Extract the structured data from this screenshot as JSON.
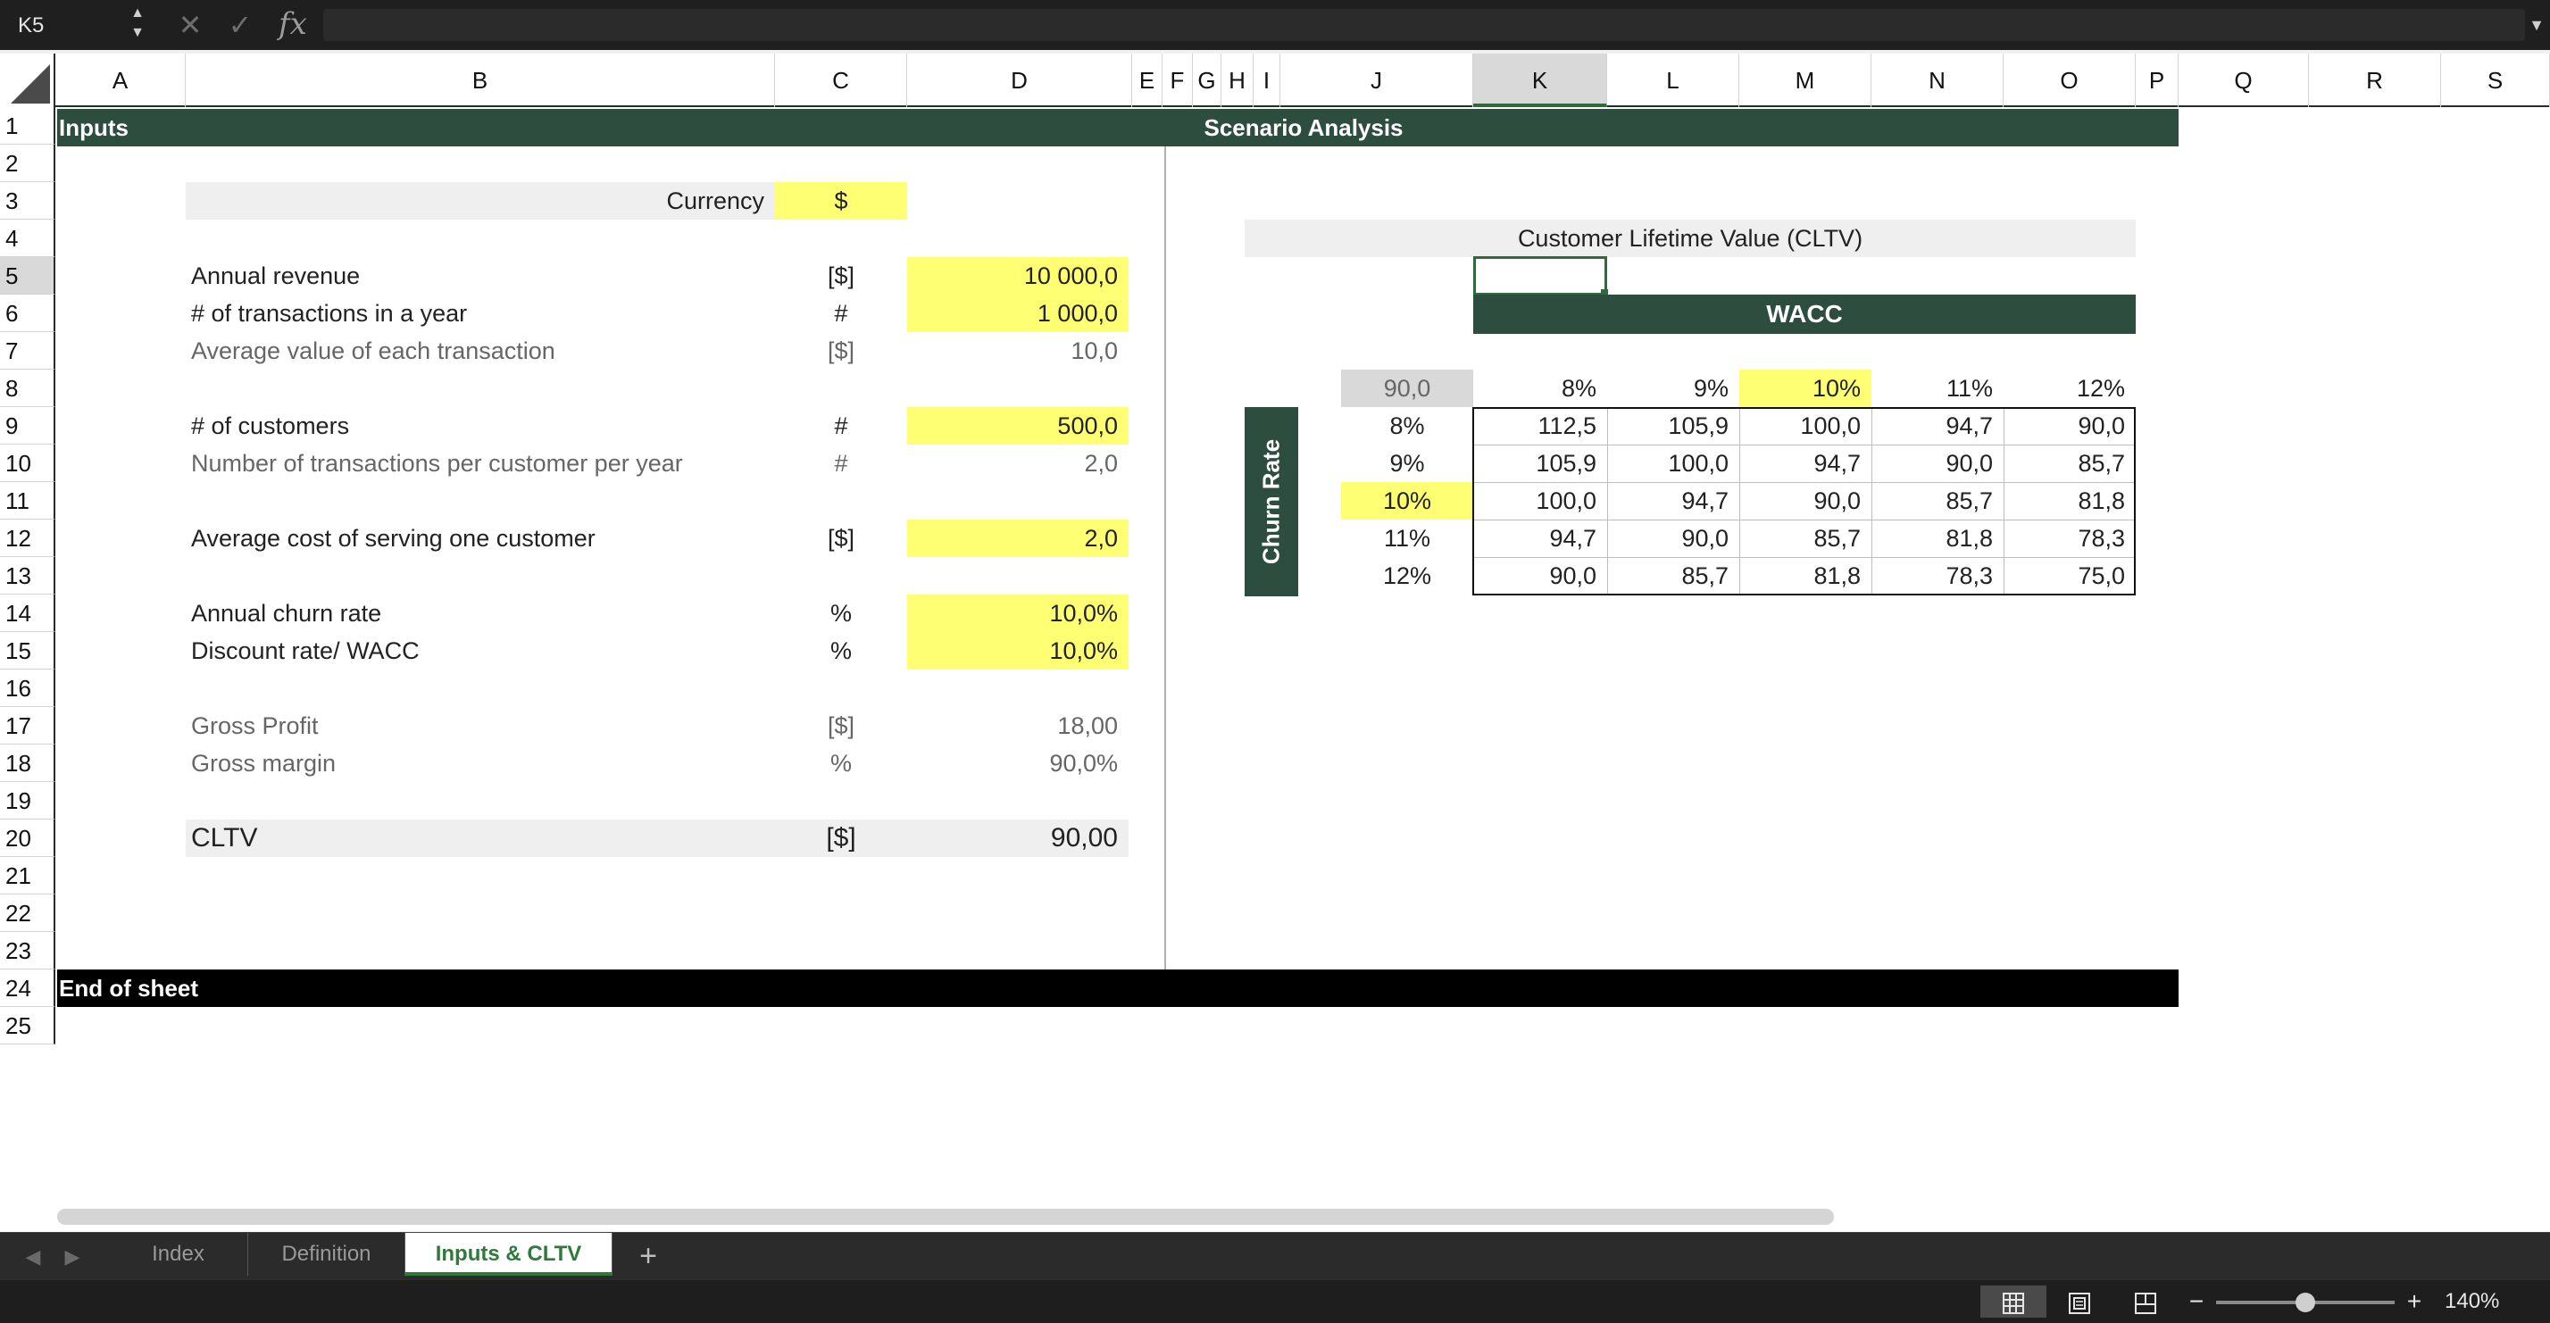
{
  "formula_bar": {
    "name_box": "K5",
    "stepper_up": "▲",
    "stepper_down": "▼",
    "cancel": "✕",
    "confirm": "✓",
    "fx": "fx",
    "formula": "",
    "dropdown": "▼"
  },
  "columns": [
    "A",
    "B",
    "C",
    "D",
    "E",
    "F",
    "G",
    "H",
    "I",
    "J",
    "K",
    "L",
    "M",
    "N",
    "O",
    "P",
    "Q",
    "R",
    "S"
  ],
  "selected_column": "K",
  "rows": [
    "1",
    "2",
    "3",
    "4",
    "5",
    "6",
    "7",
    "8",
    "9",
    "10",
    "11",
    "12",
    "13",
    "14",
    "15",
    "16",
    "17",
    "18",
    "19",
    "20",
    "21",
    "22",
    "23",
    "24",
    "25"
  ],
  "selected_row": "5",
  "sheet": {
    "inputs_band": "Inputs",
    "scenario_band": "Scenario Analysis",
    "currency_label": "Currency",
    "currency_value": "$",
    "annual_revenue": {
      "label": "Annual revenue",
      "unit": "[$]",
      "value": "10 000,0"
    },
    "transactions": {
      "label": "# of transactions in a year",
      "unit": "#",
      "value": "1 000,0"
    },
    "avg_transaction": {
      "label": "Average value of each transaction",
      "unit": "[$]",
      "value": "10,0"
    },
    "customers": {
      "label": "# of customers",
      "unit": "#",
      "value": "500,0"
    },
    "tx_per_customer": {
      "label": "Number of transactions per customer per year",
      "unit": "#",
      "value": "2,0"
    },
    "cost_serving": {
      "label": "Average cost of serving one customer",
      "unit": "[$]",
      "value": "2,0"
    },
    "churn": {
      "label": "Annual churn rate",
      "unit": "%",
      "value": "10,0%"
    },
    "discount": {
      "label": "Discount rate/ WACC",
      "unit": "%",
      "value": "10,0%"
    },
    "gross_profit": {
      "label": "Gross Profit",
      "unit": "[$]",
      "value": "18,00"
    },
    "gross_margin": {
      "label": "Gross margin",
      "unit": "%",
      "value": "90,0%"
    },
    "cltv": {
      "label": "CLTV",
      "unit": "[$]",
      "value": "90,00"
    },
    "end_band": "End of sheet"
  },
  "scenario": {
    "title": "Customer Lifetime Value (CLTV)",
    "wacc_label": "WACC",
    "churn_label": "Churn Rate",
    "corner_value": "90,0",
    "wacc_headers": [
      "8%",
      "9%",
      "10%",
      "11%",
      "12%"
    ],
    "churn_headers": [
      "8%",
      "9%",
      "10%",
      "11%",
      "12%"
    ],
    "highlight_index": 2,
    "values": [
      [
        "112,5",
        "105,9",
        "100,0",
        "94,7",
        "90,0"
      ],
      [
        "105,9",
        "100,0",
        "94,7",
        "90,0",
        "85,7"
      ],
      [
        "100,0",
        "94,7",
        "90,0",
        "85,7",
        "81,8"
      ],
      [
        "94,7",
        "90,0",
        "85,7",
        "81,8",
        "78,3"
      ],
      [
        "90,0",
        "85,7",
        "81,8",
        "78,3",
        "75,0"
      ]
    ]
  },
  "tabs": {
    "prev": "◀",
    "next": "▶",
    "items": [
      "Index",
      "Definition",
      "Inputs & CLTV"
    ],
    "active_index": 2,
    "add": "+"
  },
  "status": {
    "zoom_minus": "−",
    "zoom_plus": "+",
    "zoom": "140%",
    "zoom_fraction": 0.5
  },
  "colors": {
    "band_green": "#2d4d3f",
    "input_yellow": "#ffff73",
    "select_green": "#2f6a3a"
  }
}
